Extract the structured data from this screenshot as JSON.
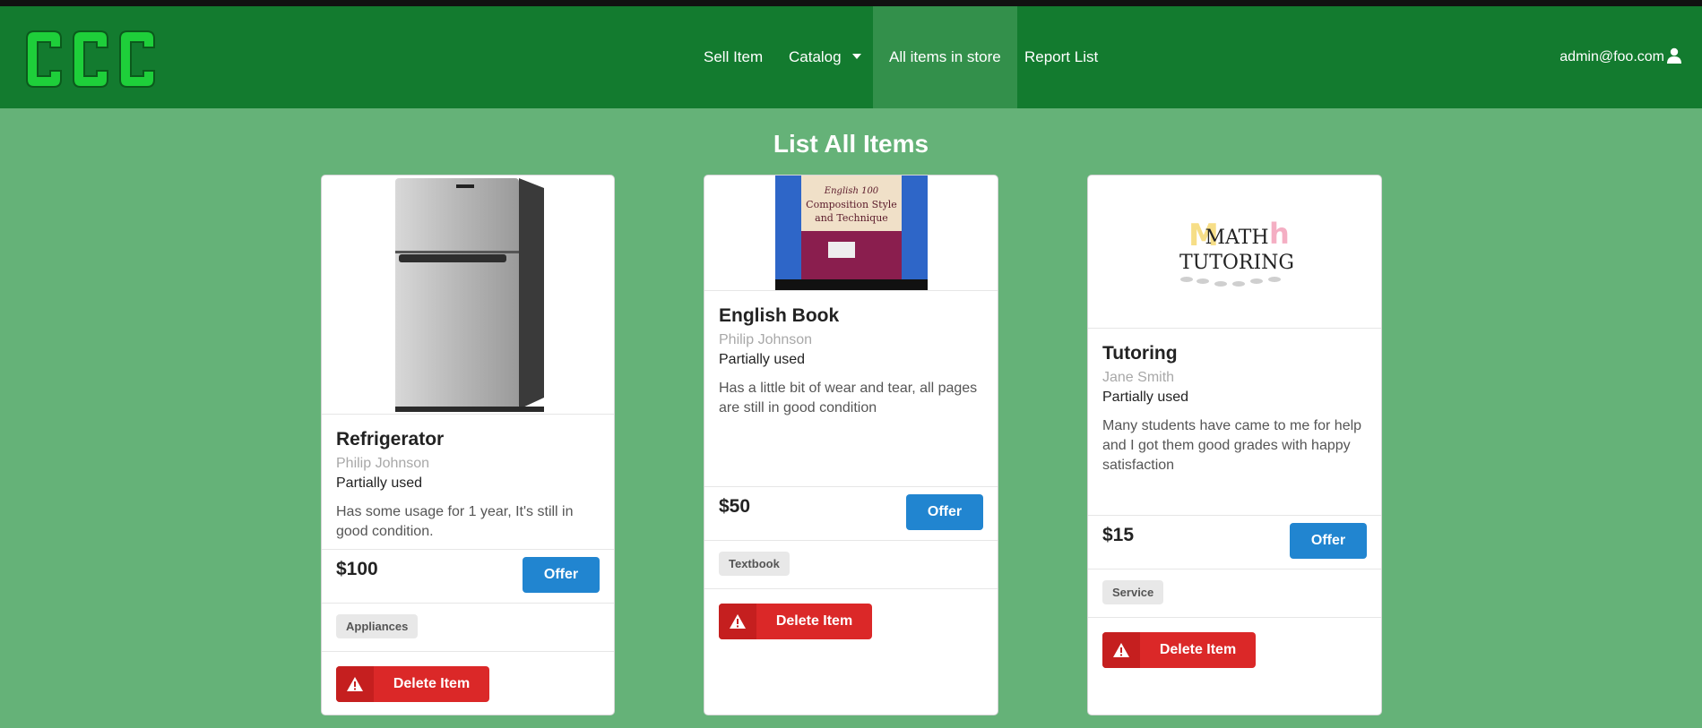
{
  "brand": {
    "logo_text": "CCC"
  },
  "nav": {
    "sell_item": "Sell Item",
    "catalog": "Catalog",
    "all_items": "All items in store",
    "report_list": "Report List",
    "user_email": "admin@foo.com"
  },
  "page": {
    "title": "List All Items"
  },
  "colors": {
    "navbar": "#137b2f",
    "background": "#65b278",
    "offer": "#2185d0",
    "delete": "#db2828"
  },
  "items": [
    {
      "name": "Refrigerator",
      "seller": "Philip Johnson",
      "condition": "Partially used",
      "description": "Has some usage for 1 year, It's still in good condition.",
      "price": "$100",
      "offer_label": "Offer",
      "tag": "Appliances",
      "delete_label": "Delete Item",
      "image": "refrigerator-photo"
    },
    {
      "name": "English Book",
      "seller": "Philip Johnson",
      "condition": "Partially used",
      "description": "Has a little bit of wear and tear, all pages are still in good condition",
      "price": "$50",
      "offer_label": "Offer",
      "tag": "Textbook",
      "delete_label": "Delete Item",
      "image": "book-photo",
      "image_text": [
        "English 100",
        "Composition Style",
        "and Technique"
      ]
    },
    {
      "name": "Tutoring",
      "seller": "Jane Smith",
      "condition": "Partially used",
      "description": "Many students have came to me for help and I got them good grades with happy satisfaction",
      "price": "$15",
      "offer_label": "Offer",
      "tag": "Service",
      "delete_label": "Delete Item",
      "image": "math-tutoring-graphic",
      "image_text": [
        "MATH",
        "TUTORING"
      ]
    }
  ]
}
